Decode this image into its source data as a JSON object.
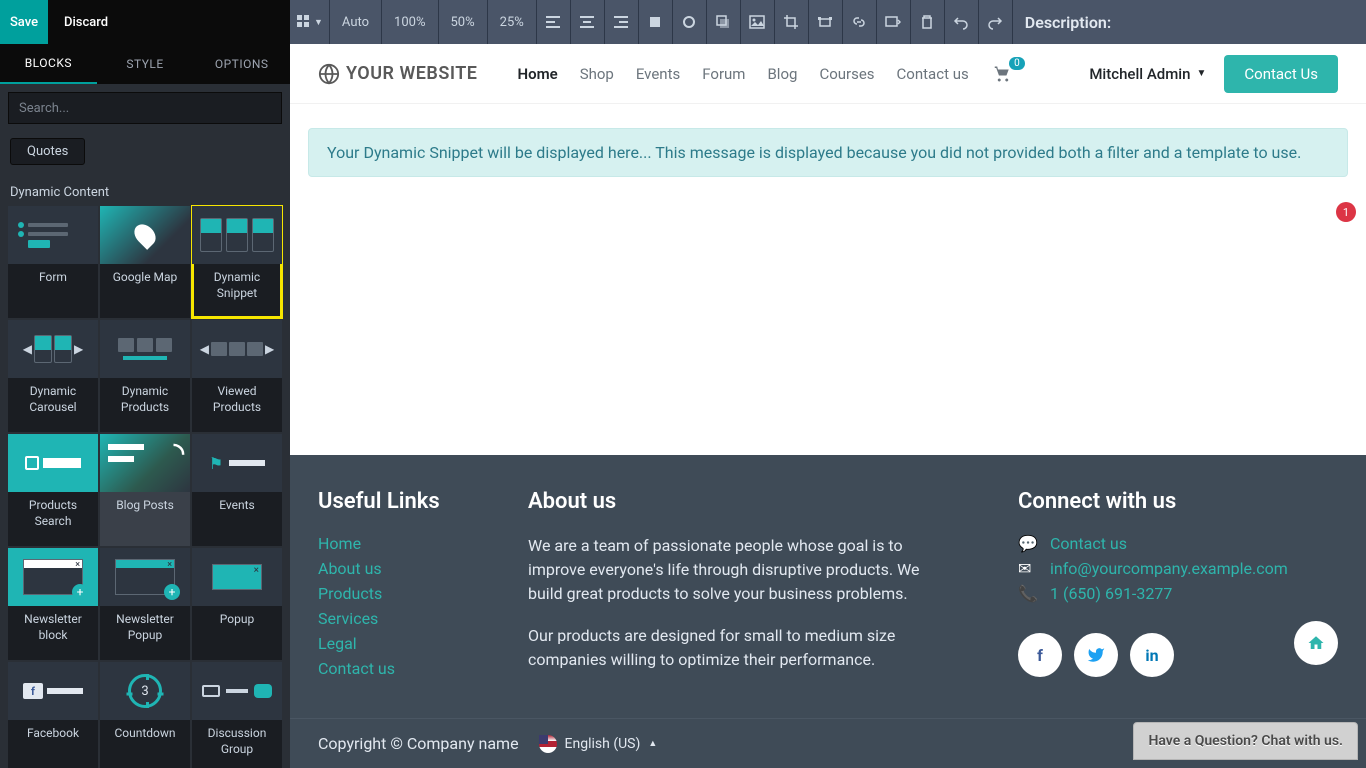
{
  "actions": {
    "save": "Save",
    "discard": "Discard"
  },
  "toolbar": {
    "zoom_auto": "Auto",
    "zoom_100": "100%",
    "zoom_50": "50%",
    "zoom_25": "25%",
    "description_label": "Description:"
  },
  "tabs": {
    "blocks": "BLOCKS",
    "style": "STYLE",
    "options": "OPTIONS"
  },
  "search": {
    "placeholder": "Search..."
  },
  "pill": {
    "quotes": "Quotes"
  },
  "section": {
    "dynamic_content": "Dynamic Content"
  },
  "blocks": {
    "form": "Form",
    "google_map": "Google Map",
    "dynamic_snippet": "Dynamic Snippet",
    "dynamic_carousel": "Dynamic Carousel",
    "dynamic_products": "Dynamic Products",
    "viewed_products": "Viewed Products",
    "products_search": "Products Search",
    "blog_posts": "Blog Posts",
    "events": "Events",
    "newsletter_block": "Newsletter block",
    "newsletter_popup": "Newsletter Popup",
    "popup": "Popup",
    "facebook": "Facebook",
    "countdown": "Countdown",
    "countdown_value": "3",
    "discussion_group": "Discussion Group"
  },
  "site": {
    "brand": "YOUR WEBSITE",
    "nav": {
      "home": "Home",
      "shop": "Shop",
      "events": "Events",
      "forum": "Forum",
      "blog": "Blog",
      "courses": "Courses",
      "contact": "Contact us"
    },
    "cart_badge": "0",
    "user": "Mitchell Admin",
    "contact_btn": "Contact Us"
  },
  "alert": {
    "text": "Your Dynamic Snippet will be displayed here... This message is displayed because you did not provided both a filter and a template to use."
  },
  "notification_count": "1",
  "footer": {
    "useful_title": "Useful Links",
    "links": {
      "home": "Home",
      "about": "About us",
      "products": "Products",
      "services": "Services",
      "legal": "Legal",
      "contact": "Contact us"
    },
    "about_title": "About us",
    "about_p1": "We are a team of passionate people whose goal is to improve everyone's life through disruptive products. We build great products to solve your business problems.",
    "about_p2": "Our products are designed for small to medium size companies willing to optimize their performance.",
    "connect_title": "Connect with us",
    "contact_link": "Contact us",
    "email": "info@yourcompany.example.com",
    "phone": "1 (650) 691-3277"
  },
  "copyright": "Copyright © Company name",
  "language": "English (US)",
  "chat": "Have a Question? Chat with us."
}
